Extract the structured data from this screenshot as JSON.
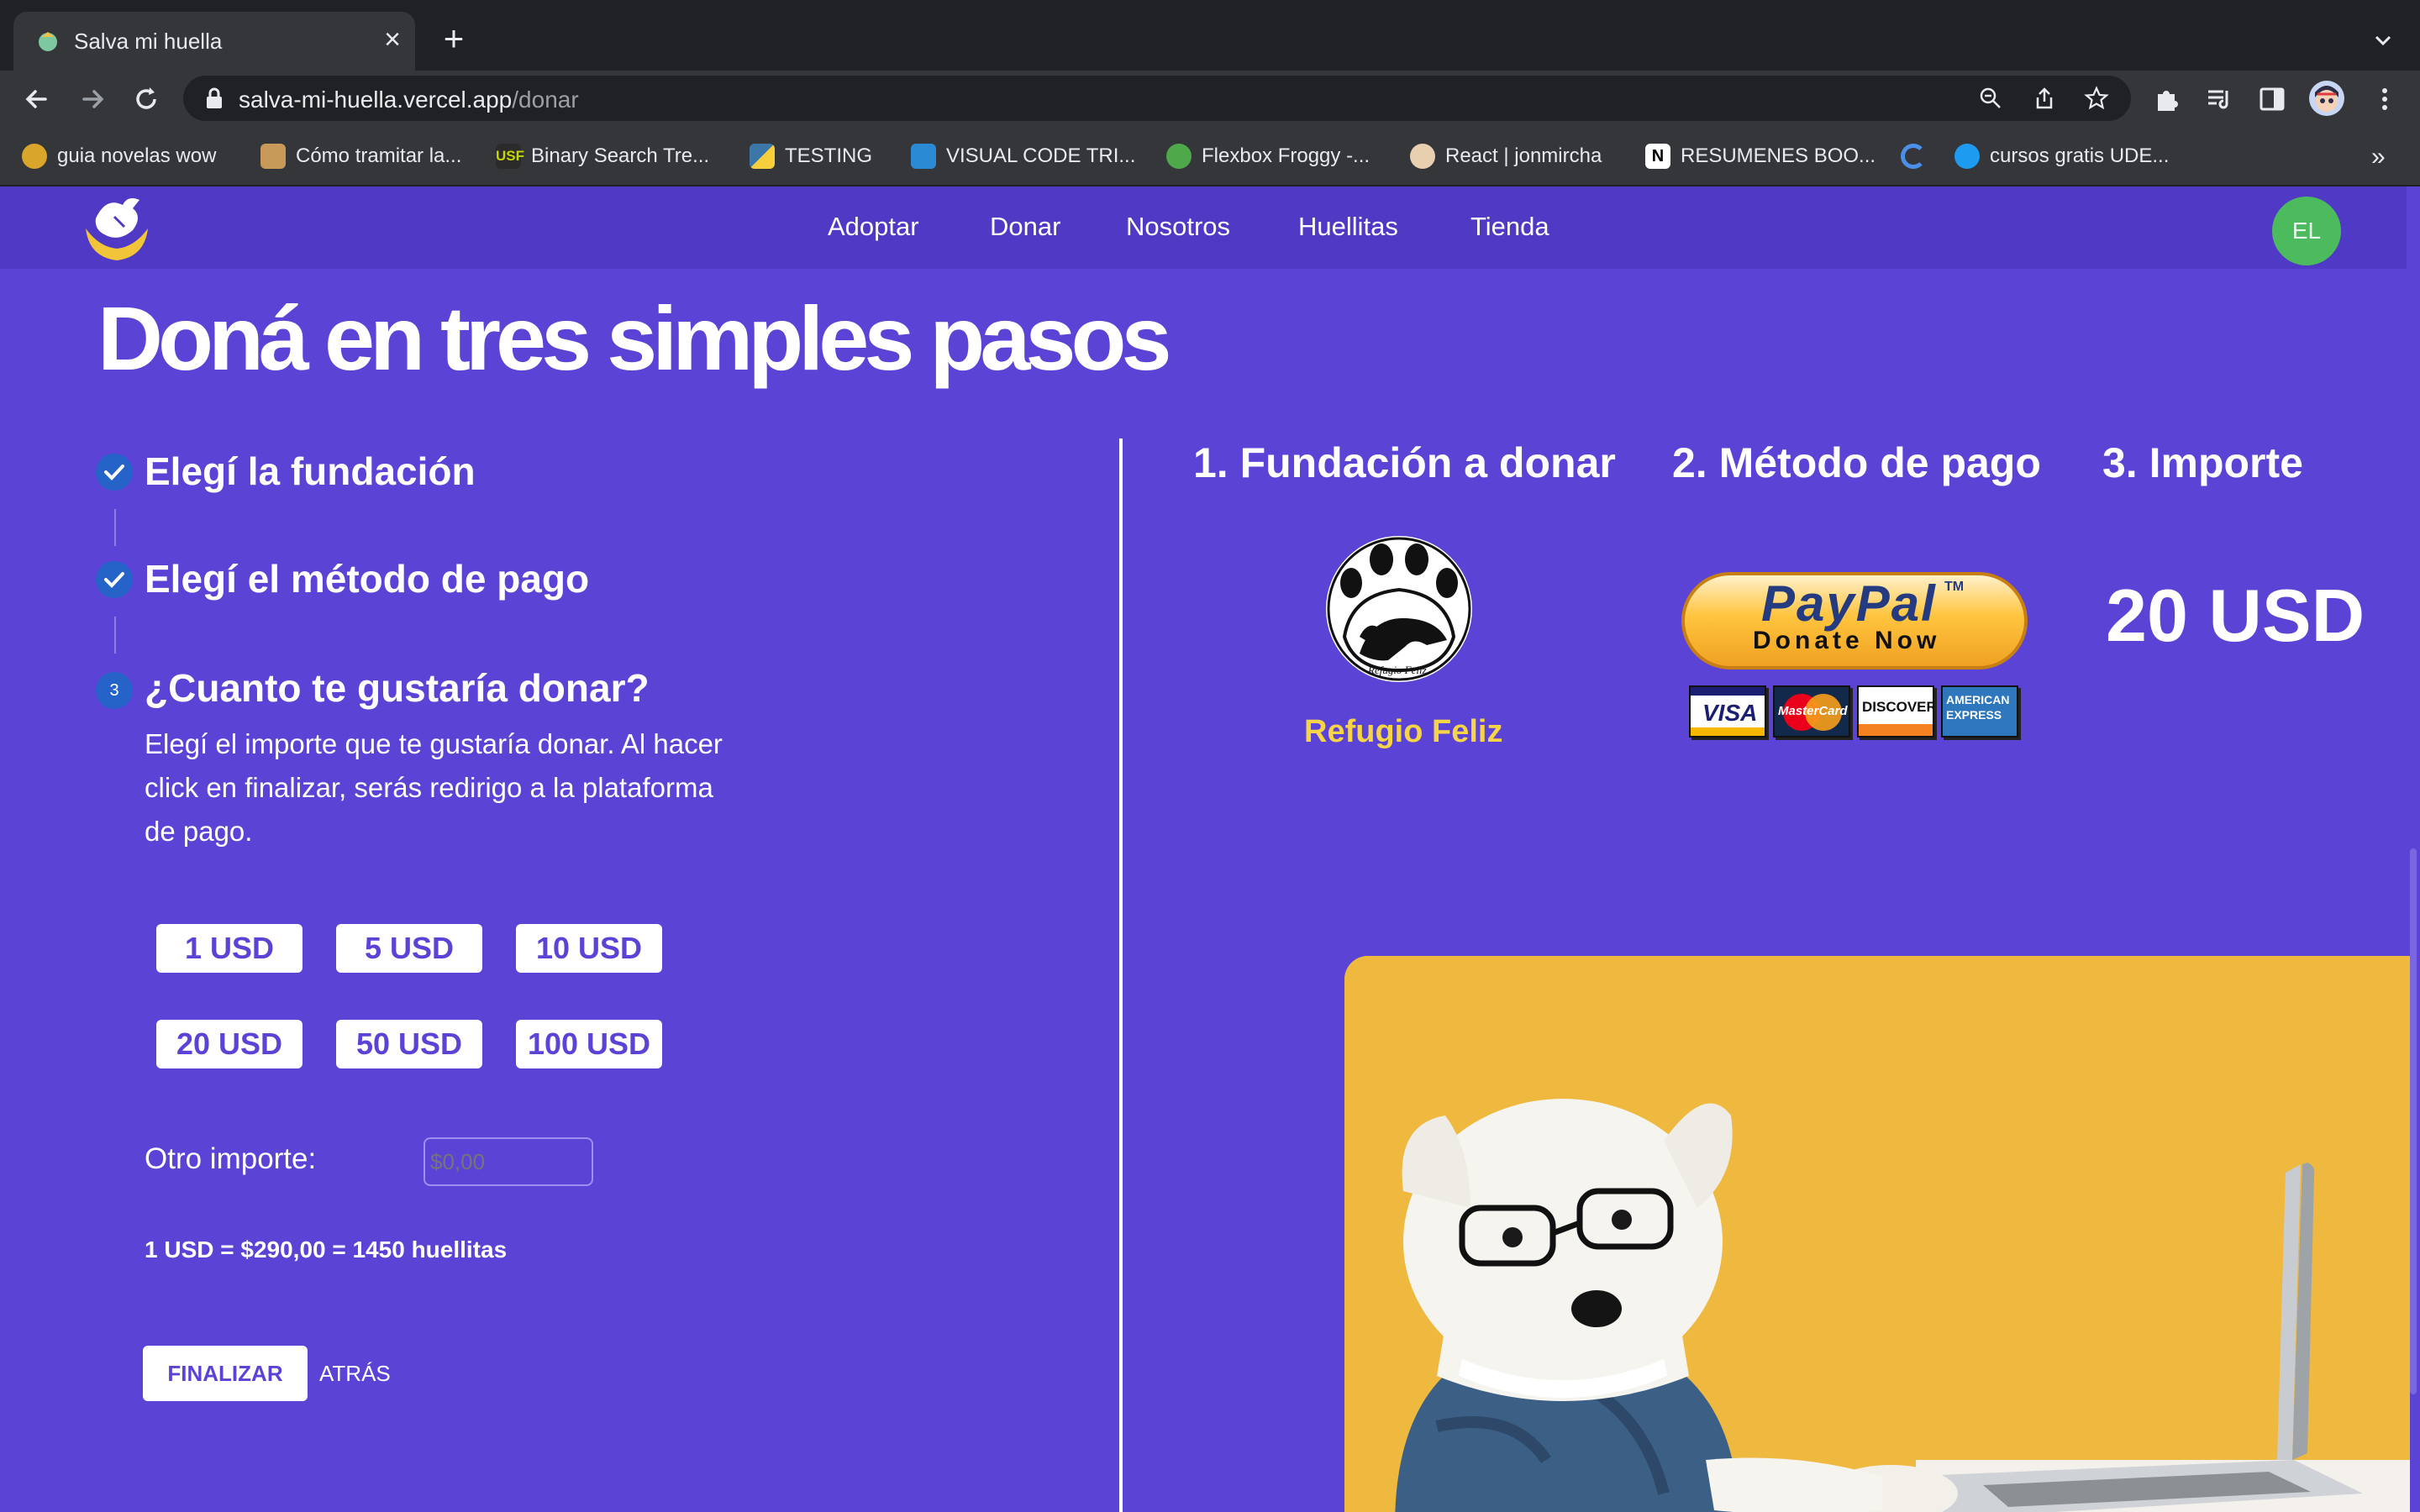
{
  "browser": {
    "tab_title": "Salva mi huella",
    "url_host": "salva-mi-huella.vercel.app",
    "url_path": "/donar",
    "bookmarks": [
      {
        "label": "guia novelas wow"
      },
      {
        "label": "Cómo tramitar la..."
      },
      {
        "label": "Binary Search Tre..."
      },
      {
        "label": "TESTING"
      },
      {
        "label": "VISUAL CODE TRI..."
      },
      {
        "label": "Flexbox Froggy -..."
      },
      {
        "label": "React | jonmircha"
      },
      {
        "label": "RESUMENES BOO..."
      },
      {
        "label": ""
      },
      {
        "label": "cursos gratis UDE..."
      }
    ],
    "bookmarks_more": "»"
  },
  "nav": {
    "links": [
      "Adoptar",
      "Donar",
      "Nosotros",
      "Huellitas",
      "Tienda"
    ],
    "user_initials": "EL"
  },
  "hero": {
    "title": "Doná en tres simples pasos"
  },
  "steps": {
    "step1_title": "Elegí la fundación",
    "step2_title": "Elegí el método de pago",
    "step3_number": "3",
    "step3_title": "¿Cuanto te gustaría donar?",
    "step3_description": "Elegí el importe que te gustaría donar. Al hacer click en finalizar, serás redirigo a la plataforma de pago."
  },
  "amounts": [
    "1 USD",
    "5 USD",
    "10 USD",
    "20 USD",
    "50 USD",
    "100 USD"
  ],
  "other_amount": {
    "label": "Otro importe:",
    "placeholder": "$0,00"
  },
  "rate_text": "1 USD = $290,00 = 1450 huellitas",
  "actions": {
    "finish": "FINALIZAR",
    "back": "ATRÁS"
  },
  "summary": {
    "foundation_heading": "1. Fundación a donar",
    "payment_heading": "2. Método de pago",
    "amount_heading": "3. Importe",
    "foundation_name": "Refugio Feliz",
    "foundation_logo_text": "Refugio Feliz",
    "paypal_brand": "PayPal",
    "paypal_tm": "TM",
    "paypal_action": "Donate Now",
    "cards": [
      "VISA",
      "MasterCard",
      "DISCOVER",
      "AMERICAN EXPRESS"
    ],
    "selected_amount": "20 USD"
  },
  "colors": {
    "page_bg": "#5b43d6",
    "nav_bg": "#5039c4",
    "accent_yellow": "#f5d547",
    "avatar_green": "#4cbb5e",
    "step_blue": "#2563c9"
  }
}
